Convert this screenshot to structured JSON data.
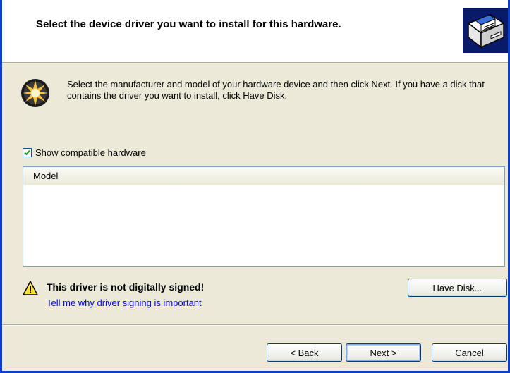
{
  "header": {
    "title": "Select the device driver you want to install for this hardware."
  },
  "intro": {
    "text": "Select the manufacturer and model of your hardware device and then click Next. If you have a disk that contains the driver you want to install, click Have Disk."
  },
  "compatible_checkbox": {
    "label": "Show compatible hardware",
    "checked": true
  },
  "model_list": {
    "column_header": "Model",
    "items": []
  },
  "warning": {
    "title": "This driver is not digitally signed!",
    "link": "Tell me why driver signing is important"
  },
  "buttons": {
    "have_disk": "Have Disk...",
    "back": "< Back",
    "next": "Next >",
    "cancel": "Cancel"
  },
  "colors": {
    "window_frame": "#0A3FCC",
    "dialog_background": "#ECE9D8",
    "link": "#0000FF"
  },
  "icons": {
    "header": "hardware-card-icon",
    "intro": "device-wizard-icon",
    "warning": "warning-triangle-icon",
    "checkbox": "checkmark-icon"
  }
}
